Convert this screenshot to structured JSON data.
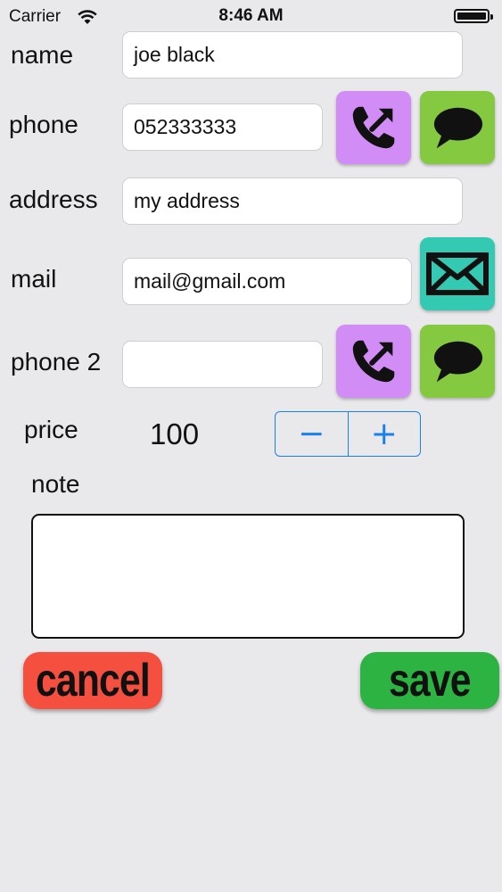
{
  "status_bar": {
    "carrier": "Carrier",
    "time": "8:46 AM"
  },
  "form": {
    "name": {
      "label": "name",
      "value": "joe black"
    },
    "phone": {
      "label": "phone",
      "value": "052333333"
    },
    "address": {
      "label": "address",
      "value": "my address"
    },
    "mail": {
      "label": "mail",
      "value": "mail@gmail.com"
    },
    "phone2": {
      "label": "phone 2",
      "value": ""
    },
    "price": {
      "label": "price",
      "value": "100",
      "decrement": "−",
      "increment": "+"
    },
    "note": {
      "label": "note",
      "value": ""
    }
  },
  "actions": {
    "cancel": "cancel",
    "save": "save"
  },
  "colors": {
    "background": "#e9e8ea",
    "call_button": "#d18cf5",
    "sms_button": "#84c940",
    "mail_button": "#33c9b2",
    "cancel_button": "#f5503f",
    "save_button": "#2db342",
    "stepper_tint": "#1a7ff0"
  },
  "icons": {
    "call": "phone-outgoing-icon",
    "sms": "speech-bubble-icon",
    "mail": "envelope-icon"
  }
}
